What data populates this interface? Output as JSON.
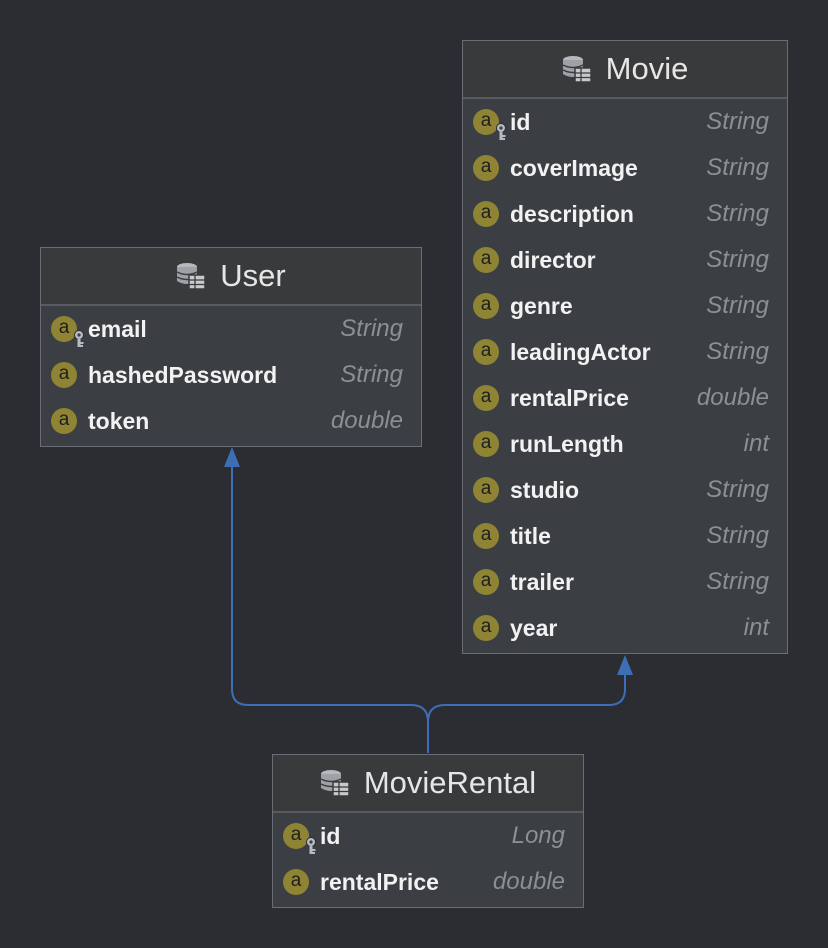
{
  "entities": {
    "user": {
      "name": "User",
      "fields": [
        {
          "name": "email",
          "type": "String",
          "key": true
        },
        {
          "name": "hashedPassword",
          "type": "String",
          "key": false
        },
        {
          "name": "token",
          "type": "double",
          "key": false
        }
      ]
    },
    "movie": {
      "name": "Movie",
      "fields": [
        {
          "name": "id",
          "type": "String",
          "key": true
        },
        {
          "name": "coverImage",
          "type": "String",
          "key": false
        },
        {
          "name": "description",
          "type": "String",
          "key": false
        },
        {
          "name": "director",
          "type": "String",
          "key": false
        },
        {
          "name": "genre",
          "type": "String",
          "key": false
        },
        {
          "name": "leadingActor",
          "type": "String",
          "key": false
        },
        {
          "name": "rentalPrice",
          "type": "double",
          "key": false
        },
        {
          "name": "runLength",
          "type": "int",
          "key": false
        },
        {
          "name": "studio",
          "type": "String",
          "key": false
        },
        {
          "name": "title",
          "type": "String",
          "key": false
        },
        {
          "name": "trailer",
          "type": "String",
          "key": false
        },
        {
          "name": "year",
          "type": "int",
          "key": false
        }
      ]
    },
    "movieRental": {
      "name": "MovieRental",
      "fields": [
        {
          "name": "id",
          "type": "Long",
          "key": true
        },
        {
          "name": "rentalPrice",
          "type": "double",
          "key": false
        }
      ]
    }
  },
  "field_badge_letter": "a",
  "relations": [
    {
      "from": "MovieRental",
      "to": "User"
    },
    {
      "from": "MovieRental",
      "to": "Movie"
    }
  ],
  "colors": {
    "background": "#2b2d33",
    "connector": "#3e6eb5",
    "badge": "#8f8433"
  },
  "icons": {
    "entity": "database-table-icon",
    "field": "field-a-icon",
    "primary_key": "key-icon"
  }
}
